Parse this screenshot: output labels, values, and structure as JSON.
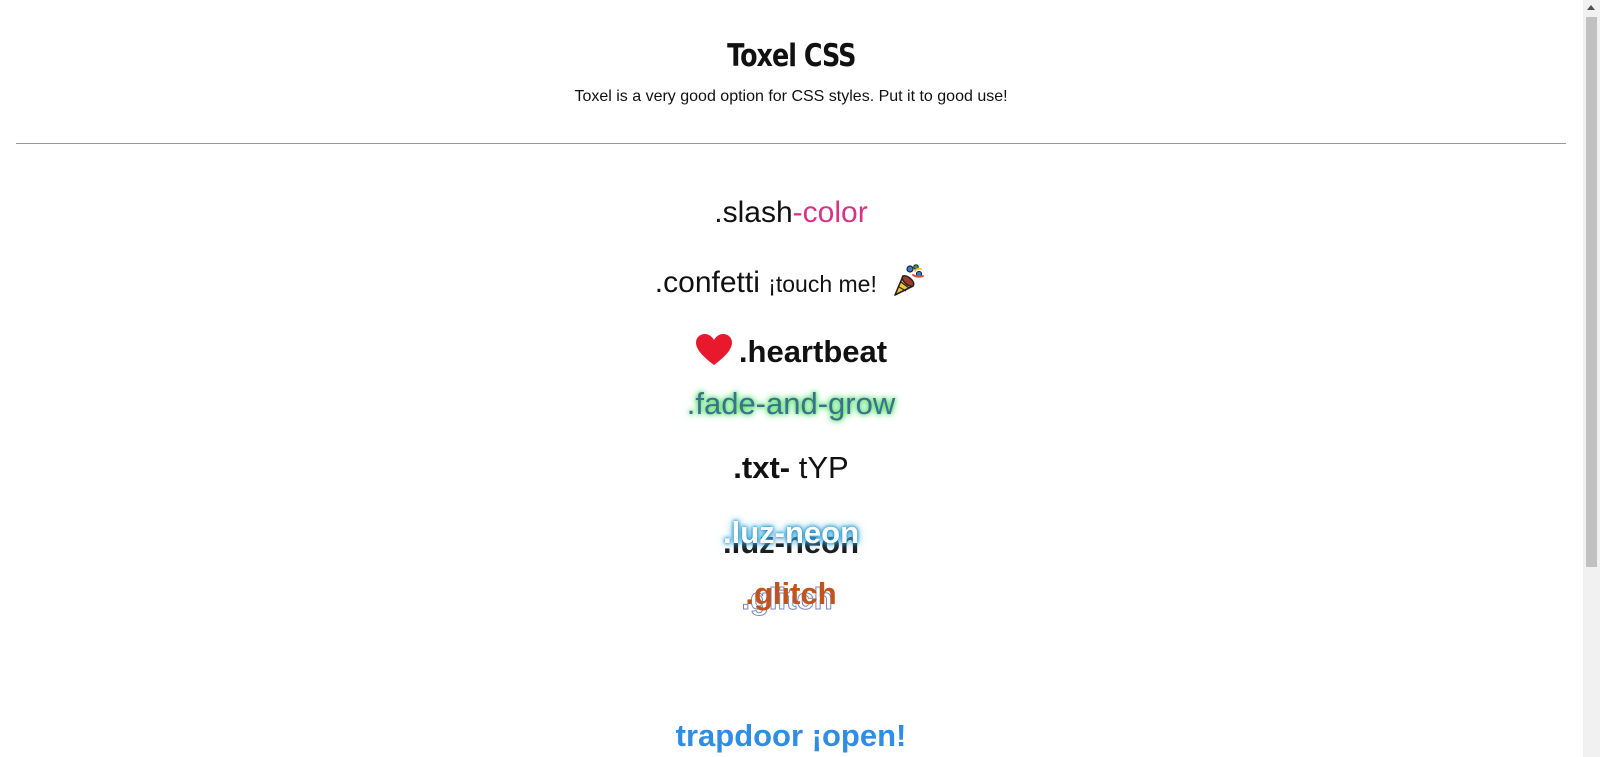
{
  "header": {
    "title": "Toxel CSS",
    "subtitle": "Toxel is a very good option for CSS styles. Put it to good use!"
  },
  "demos": {
    "slash_color": {
      "part1": ".slash",
      "part2": "-color",
      "accent_color": "#d63384"
    },
    "confetti": {
      "label": ".confetti",
      "hint": "¡touch me!",
      "icon": "party-popper-icon"
    },
    "heartbeat": {
      "label": ".heartbeat",
      "icon": "heart-icon",
      "icon_color": "#e8192c"
    },
    "fade_and_grow": {
      "label": ".fade-and-grow",
      "glow_color": "#3ddc5a"
    },
    "txt_type": {
      "bold": ".txt-",
      "normal": " tYP"
    },
    "luz_neon": {
      "label": ".luz-neon",
      "glow_color": "#2a9fd8"
    },
    "glitch": {
      "label": ".glitch",
      "color": "#c0541c"
    },
    "trapdoor": {
      "label": "trapdoor ¡open!",
      "color": "#2f8de4"
    }
  }
}
